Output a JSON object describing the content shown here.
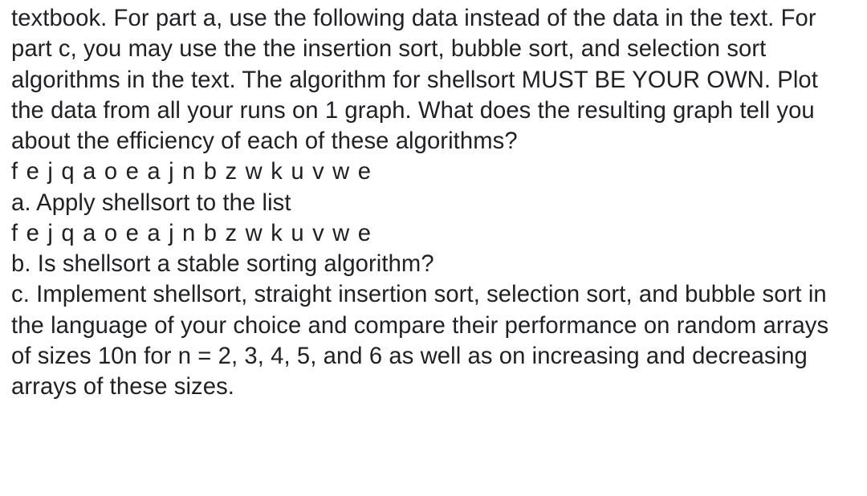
{
  "problem": {
    "intro": "textbook. For part a, use the following data instead of the data in the text. For part c, you may use the the insertion sort, bubble sort, and selection sort algorithms in the text. The algorithm for shellsort MUST BE YOUR OWN. Plot the data from all your runs on 1 graph. What does the resulting graph tell you about the efficiency of each of these algorithms?",
    "data_line_1": "f e j q a o e a j n b z w k u v w e",
    "part_a": "a. Apply shellsort to the list",
    "data_line_2": "f e j q a o e a j n b z w k u v w e",
    "part_b": "b. Is shellsort a stable sorting algorithm?",
    "part_c": "c. Implement shellsort, straight insertion sort, selection sort, and bubble sort in the language of your choice and compare their performance on random arrays of sizes 10n for n = 2, 3, 4, 5, and 6 as well as on increasing and decreasing arrays of these sizes."
  }
}
